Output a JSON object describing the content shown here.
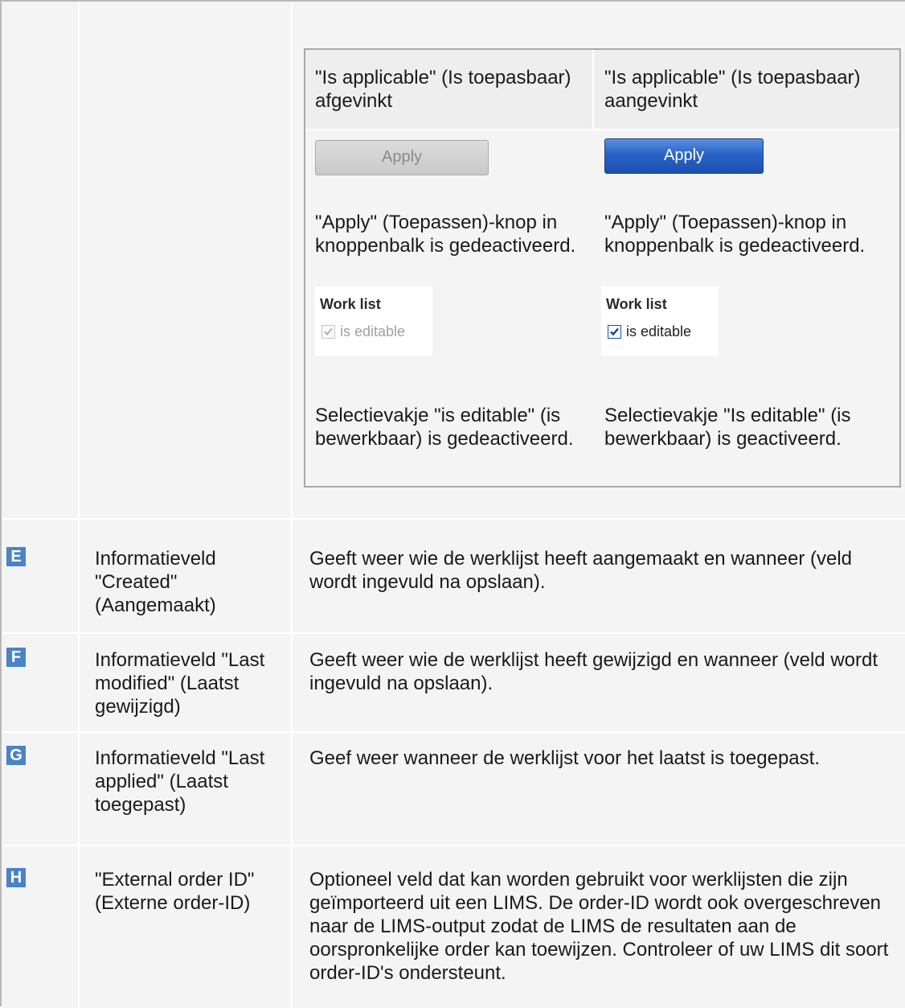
{
  "compare": {
    "col_unchecked_header": "\"Is applicable\" (Is toepasbaar) afgevinkt",
    "col_checked_header": "\"Is applicable\" (Is toepasbaar) aangevinkt",
    "apply_label": "Apply",
    "apply_desc_unchecked": "\"Apply\" (Toepassen)-knop in knoppenbalk is gedeactiveerd.",
    "apply_desc_checked": "\"Apply\" (Toepassen)-knop in knoppenbalk is gedeactiveerd.",
    "worklist_title": "Work list",
    "editable_label": "is editable",
    "editable_desc_unchecked": "Selectievakje \"is editable\" (is bewerkbaar) is gedeactiveerd.",
    "editable_desc_checked": "Selectievakje \"Is editable\" (is bewerkbaar) is geactiveerd."
  },
  "rows": [
    {
      "badge": "E",
      "field": "Informatieveld \"Created\" (Aangemaakt)",
      "desc": "Geeft weer wie de werklijst heeft aangemaakt en wanneer (veld wordt ingevuld na opslaan)."
    },
    {
      "badge": "F",
      "field": "Informatieveld \"Last modified\" (Laatst gewijzigd)",
      "desc": "Geeft weer wie de werklijst heeft gewijzigd en wanneer (veld wordt ingevuld na opslaan)."
    },
    {
      "badge": "G",
      "field": "Informatieveld \"Last applied\" (Laatst toegepast)",
      "desc": "Geef weer wanneer de werklijst voor het laatst is toegepast."
    },
    {
      "badge": "H",
      "field": "\"External order ID\" (Externe order-ID)",
      "desc": "Optioneel veld dat kan worden gebruikt voor werklijsten die zijn geïmporteerd uit een LIMS. De order-ID wordt ook overgeschreven naar de LIMS-output zodat de LIMS de resultaten aan de oorspronkelijke order kan toewijzen. Controleer of uw LIMS dit soort order-ID's ondersteunt."
    }
  ]
}
